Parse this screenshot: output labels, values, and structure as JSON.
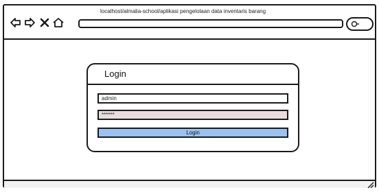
{
  "browser": {
    "title_url": "localhost/almalia-school/aplikasi pengelolaan data inventaris barang",
    "address_value": "",
    "icons": [
      "back-arrow-icon",
      "forward-arrow-icon",
      "close-x-icon",
      "home-icon",
      "search-icon"
    ]
  },
  "card": {
    "title": "Login",
    "username_value": "admin",
    "password_value": "******",
    "button_label": "Login"
  },
  "colors": {
    "button_bg": "#9cc2f0",
    "password_bg": "#e8dcdc",
    "stroke": "#1a1a1a"
  }
}
